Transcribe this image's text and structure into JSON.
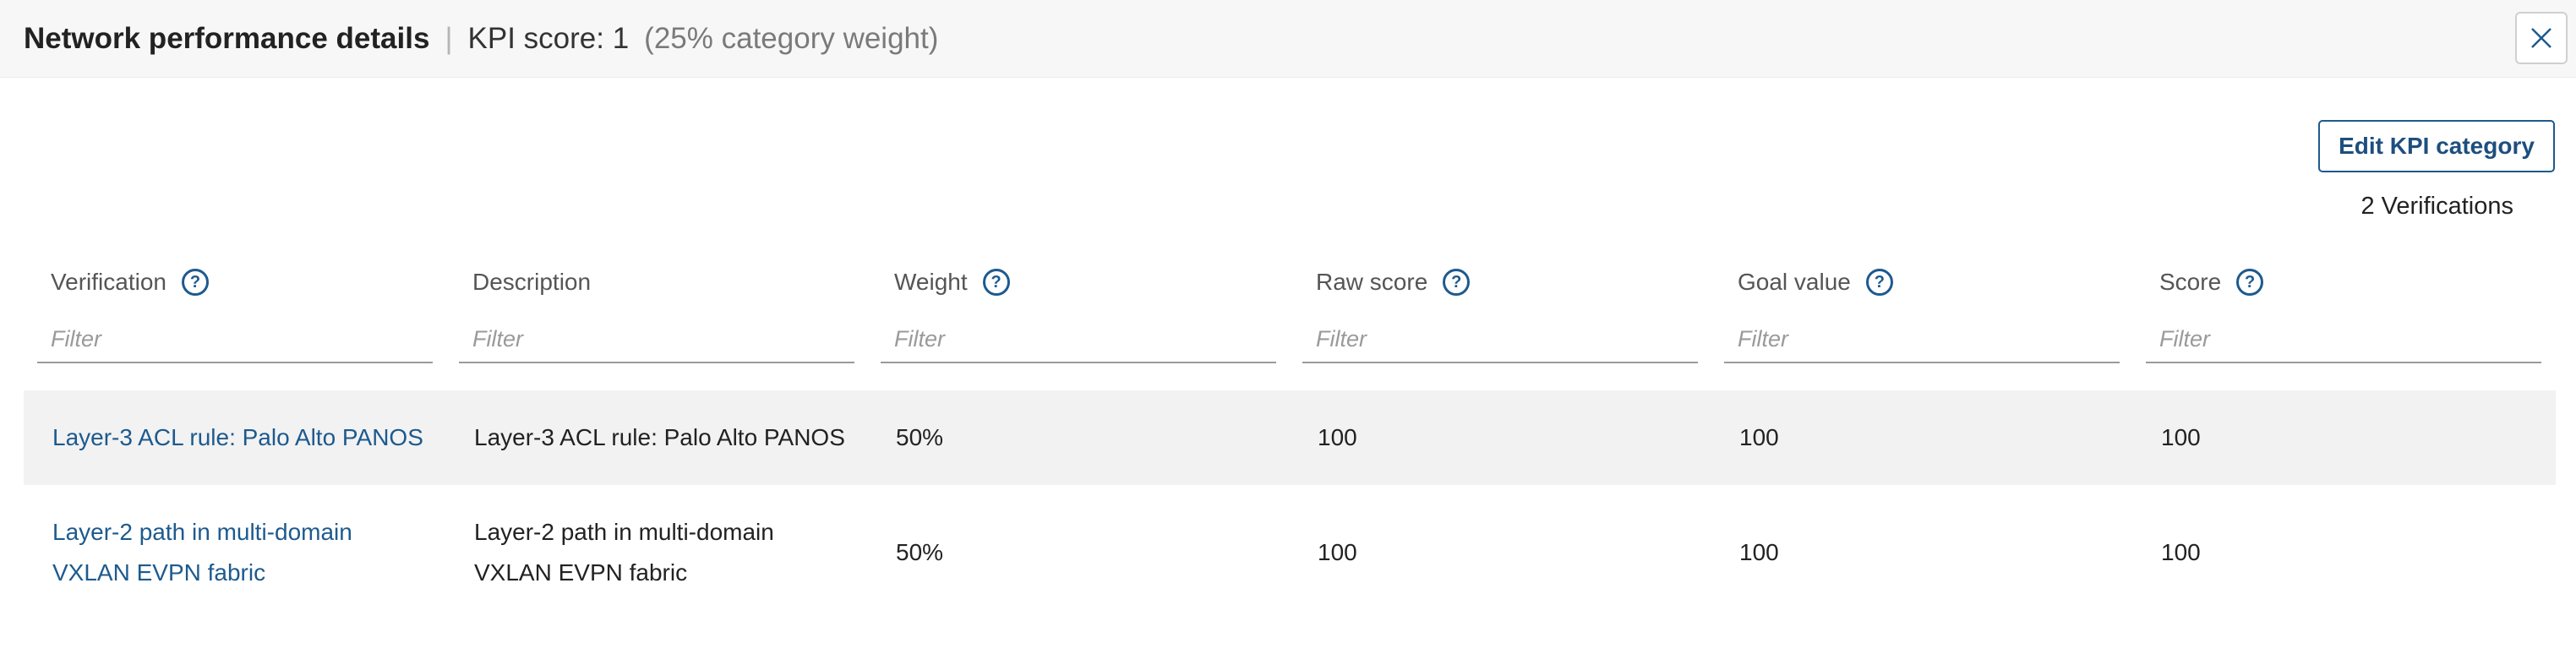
{
  "header": {
    "title": "Network performance details",
    "separator": "|",
    "kpi_score": "KPI score: 1",
    "category_weight": "(25% category weight)"
  },
  "actions": {
    "edit_label": "Edit KPI category",
    "verification_count": "2 Verifications"
  },
  "table": {
    "columns": [
      {
        "label": "Verification",
        "help": "?",
        "filter_placeholder": "Filter"
      },
      {
        "label": "Description",
        "filter_placeholder": "Filter"
      },
      {
        "label": "Weight",
        "help": "?",
        "filter_placeholder": "Filter"
      },
      {
        "label": "Raw score",
        "help": "?",
        "filter_placeholder": "Filter"
      },
      {
        "label": "Goal value",
        "help": "?",
        "filter_placeholder": "Filter"
      },
      {
        "label": "Score",
        "help": "?",
        "filter_placeholder": "Filter"
      }
    ],
    "rows": [
      {
        "verification": "Layer-3 ACL rule: Palo Alto PANOS",
        "description": "Layer-3 ACL rule: Palo Alto PANOS",
        "weight": "50%",
        "raw_score": "100",
        "goal_value": "100",
        "score": "100"
      },
      {
        "verification": "Layer-2 path in multi-domain VXLAN EVPN fabric",
        "description": "Layer-2 path in multi-domain VXLAN EVPN fabric",
        "weight": "50%",
        "raw_score": "100",
        "goal_value": "100",
        "score": "100"
      }
    ]
  },
  "icons": {
    "close": "close-icon",
    "help": "help-icon"
  },
  "colors": {
    "accent": "#1d5a8e",
    "header_bg": "#f7f7f7",
    "row_highlight": "#f2f2f2"
  }
}
